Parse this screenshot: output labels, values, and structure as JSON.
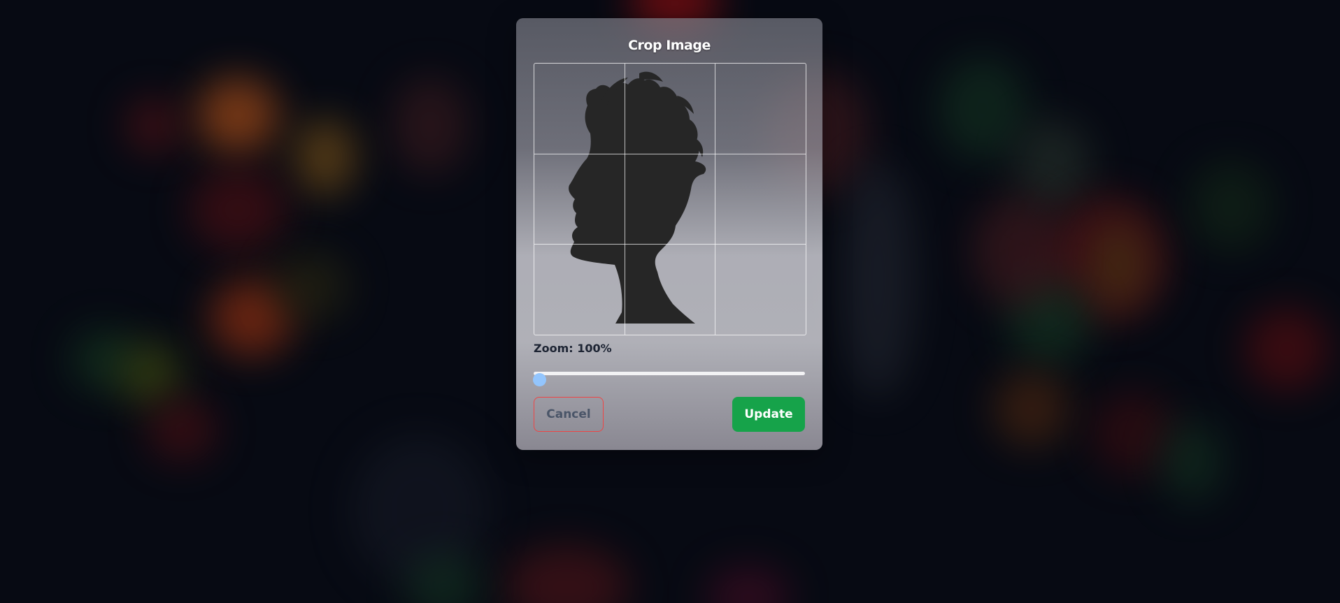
{
  "dialog": {
    "title": "Crop Image",
    "zoom_label": "Zoom: 100%",
    "zoom_value": 1.0,
    "cancel_label": "Cancel",
    "update_label": "Update"
  },
  "colors": {
    "update_button": "#16a34a",
    "cancel_border": "#ef4444",
    "slider_thumb": "#93c5fd",
    "silhouette": "#262626"
  },
  "icons": {
    "crop_image": "person-profile-silhouette"
  }
}
